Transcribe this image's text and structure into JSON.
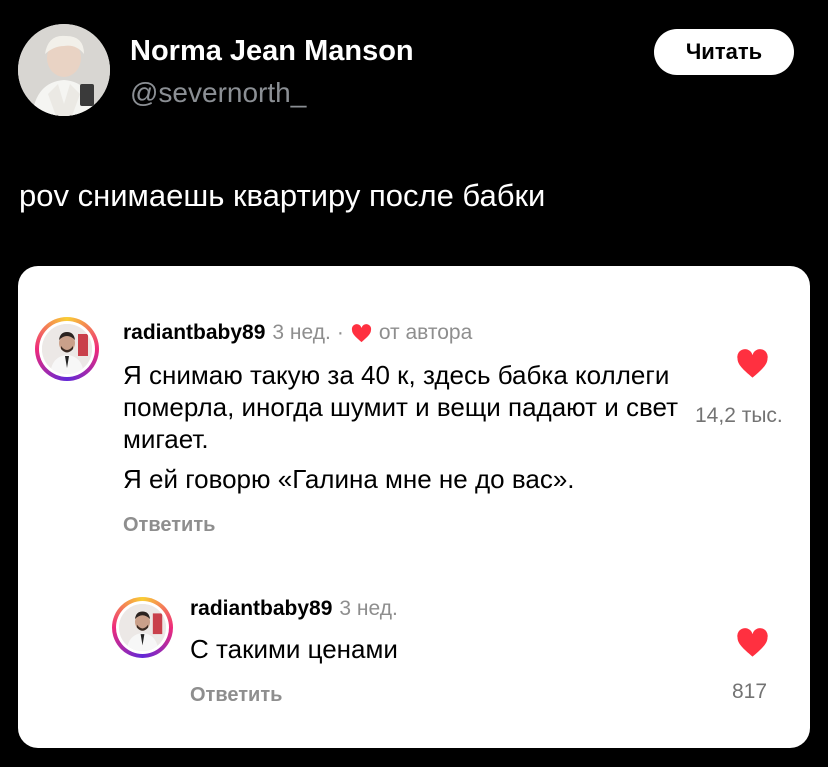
{
  "tweet": {
    "author_name": "Norma Jean Manson",
    "author_handle": "@severnorth_",
    "read_button": "Читать",
    "text": "pov снимаешь квартиру после бабки"
  },
  "comments": [
    {
      "username": "radiantbaby89",
      "time": "3 нед.",
      "separator": "·",
      "author_badge": "от автора",
      "paragraph_1": "Я снимаю такую за 40 к, здесь бабка коллеги померла, иногда шумит и вещи падают и свет мигает.",
      "paragraph_2": "Я ей говорю «Галина  мне не до вас».",
      "reply_label": "Ответить",
      "likes": "14,2 тыс."
    },
    {
      "username": "radiantbaby89",
      "time": "3 нед.",
      "text": "С такими ценами",
      "reply_label": "Ответить",
      "likes": "817"
    }
  ],
  "colors": {
    "background": "#000000",
    "heart": "#ff3040",
    "muted_text": "#8e8e8e"
  }
}
